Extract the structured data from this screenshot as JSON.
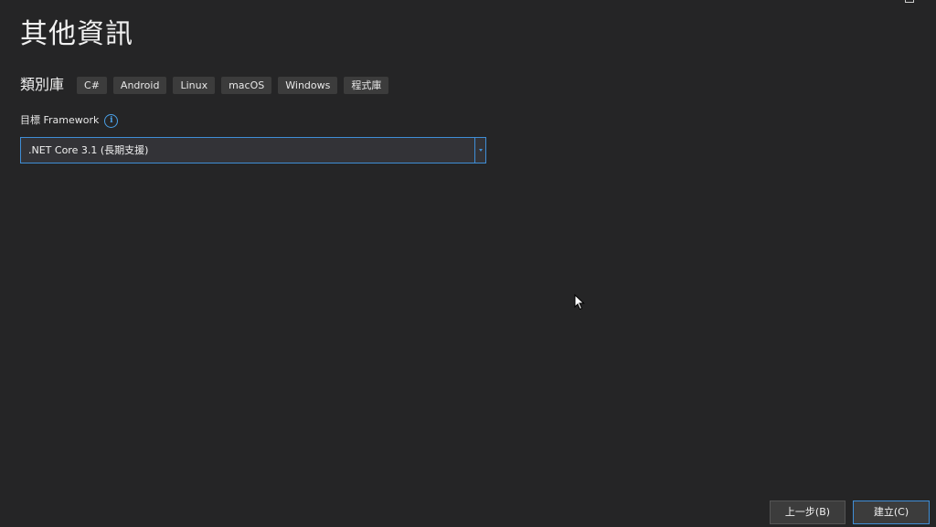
{
  "page": {
    "title": "其他資訊"
  },
  "tags": {
    "label": "類別庫",
    "items": [
      "C#",
      "Android",
      "Linux",
      "macOS",
      "Windows",
      "程式庫"
    ]
  },
  "framework": {
    "label": "目標 Framework",
    "info_icon": "info-icon",
    "selected_value": ".NET Core 3.1 (長期支援)"
  },
  "footer": {
    "back_label": "上一步(B)",
    "create_label": "建立(C)"
  },
  "colors": {
    "background": "#252526",
    "accent": "#3f8ed6",
    "tag_background": "#3c3c3c"
  }
}
